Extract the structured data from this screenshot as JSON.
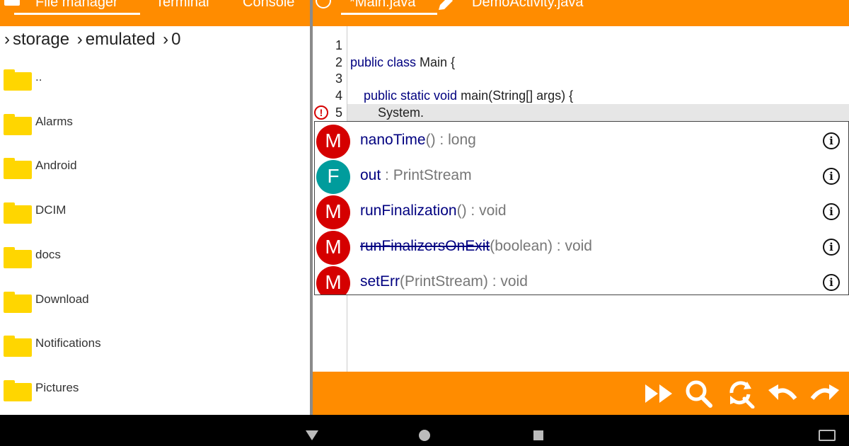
{
  "colors": {
    "accent": "#FF8C00",
    "folder": "#FFD600",
    "method_badge": "#D50000",
    "field_badge": "#009C9C",
    "keyword": "#000080"
  },
  "left_tabs": [
    "File manager",
    "Terminal",
    "Console"
  ],
  "breadcrumb": [
    "storage",
    "emulated",
    "0"
  ],
  "breadcrumb_sep": "›",
  "files": [
    "..",
    "Alarms",
    "Android",
    "DCIM",
    "docs",
    "Download",
    "Notifications",
    "Pictures"
  ],
  "editor_tabs": [
    "*Main.java",
    "DemoActivity.java"
  ],
  "line_numbers": [
    "1",
    "2",
    "3",
    "4",
    "5"
  ],
  "code": {
    "line2_kw": "public class",
    "line2_rest": " Main {",
    "line4_kw": "public static void",
    "line4_rest": " main(String[] args) {",
    "line5": "System."
  },
  "suggestions": [
    {
      "badge": "M",
      "kind": "method",
      "name": "nanoTime",
      "rest": "() : long",
      "deprecated": false
    },
    {
      "badge": "F",
      "kind": "field",
      "name": "out",
      "rest": " : PrintStream",
      "deprecated": false
    },
    {
      "badge": "M",
      "kind": "method",
      "name": "runFinalization",
      "rest": "() : void",
      "deprecated": false
    },
    {
      "badge": "M",
      "kind": "method",
      "name": "runFinalizersOnExit",
      "rest": "(boolean) : void",
      "deprecated": true
    },
    {
      "badge": "M",
      "kind": "method",
      "name": "setErr",
      "rest": "(PrintStream) : void",
      "deprecated": false
    }
  ],
  "toolbar_icons": [
    "fast-forward-icon",
    "search-icon",
    "replace-icon",
    "undo-icon",
    "redo-icon"
  ],
  "nav_icons": [
    "back-icon",
    "home-icon",
    "recents-icon",
    "keyboard-icon"
  ]
}
